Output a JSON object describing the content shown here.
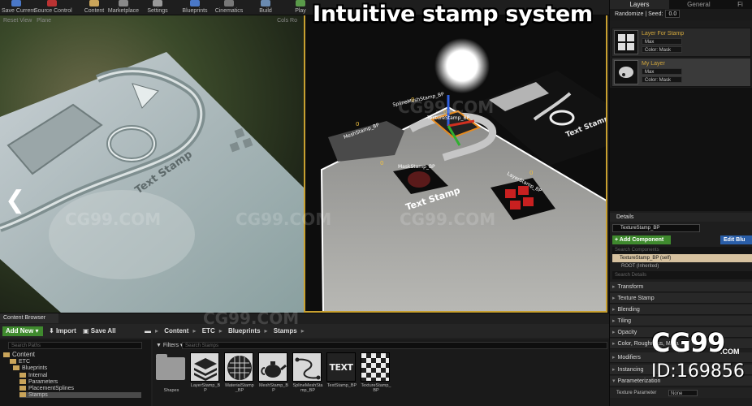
{
  "banner": {
    "title": "Intuitive stamp system"
  },
  "toolbar": {
    "buttons": [
      {
        "label": "Save Current"
      },
      {
        "label": "Source Control"
      },
      {
        "label": "Content"
      },
      {
        "label": "Marketplace"
      },
      {
        "label": "Settings"
      },
      {
        "label": "Blueprints"
      },
      {
        "label": "Cinematics"
      },
      {
        "label": "Build"
      },
      {
        "label": "Play"
      }
    ]
  },
  "viewport_left": {
    "header_left": "Reset View",
    "header_mode": "Plane",
    "header_right": "Cols Ro",
    "surface_text": "Text Stamp"
  },
  "viewport_right": {
    "labels": {
      "spline": "SplineMeshStamp_BP",
      "mesh": "MeshStamp_BP",
      "texture": "TextureStamp_BP",
      "mask": "MaskStamp_BP",
      "layer": "LayerStamp_BP",
      "zero": "0"
    },
    "surface_text": "Text Stamp",
    "dark_plate_text": "Text Stamp"
  },
  "layers_panel": {
    "tabs": [
      "Layers",
      "General",
      "Fi"
    ],
    "randomize_label": "Randomize | Seed:",
    "seed_value": "0.0",
    "layers": [
      {
        "name": "Layer For Stamp",
        "mode": "Max",
        "color": "Color: Mask"
      },
      {
        "name": "My Layer",
        "mode": "Max",
        "color": "Color: Mask"
      }
    ]
  },
  "details_panel": {
    "tab": "Details",
    "object_name": "TextureStamp_BP",
    "add_component": "+ Add Component",
    "edit_blueprint": "Edit Blu",
    "search_components": "Search Components",
    "self_component": "TextureStamp_BP (self)",
    "root_component": "ROOT (Inherited)",
    "search_details": "Search Details",
    "categories": [
      "Transform",
      "Texture Stamp",
      "Blending",
      "Tiling",
      "Opacity",
      "Color, Roughness, Meta",
      "Modifiers",
      "Instancing",
      "Parameterization"
    ],
    "texture_parameter_label": "Texture Parameter",
    "texture_parameter_value": "None"
  },
  "content_browser": {
    "tab": "Content Browser",
    "add_new": "Add New",
    "import": "Import",
    "save_all": "Save All",
    "breadcrumb": [
      "Content",
      "ETC",
      "Blueprints",
      "Stamps"
    ],
    "search_paths": "Search Paths",
    "filters": "Filters",
    "search_assets": "Search Stamps",
    "tree": [
      {
        "label": "Content",
        "depth": 0
      },
      {
        "label": "ETC",
        "depth": 1
      },
      {
        "label": "Blueprints",
        "depth": 2
      },
      {
        "label": "Internal",
        "depth": 3
      },
      {
        "label": "Parameters",
        "depth": 3
      },
      {
        "label": "PlacementSplines",
        "depth": 3
      },
      {
        "label": "Stamps",
        "depth": 3
      }
    ],
    "assets": [
      {
        "label": "Shapes"
      },
      {
        "label": "LayerStamp_BP"
      },
      {
        "label": "MaterialStamp_BP"
      },
      {
        "label": "MeshStamp_BP"
      },
      {
        "label": "SplineMeshStamp_BP"
      },
      {
        "label": "TextStamp_BP"
      },
      {
        "label": "TextureStamp_BP"
      }
    ],
    "text_thumb": "TEXT"
  },
  "watermark": {
    "logo": "CG99",
    "domain": ".COM",
    "id": "ID:169856",
    "overlay": "CG99.COM"
  },
  "colors": {
    "accent_green": "#3f8a2e",
    "accent_blue": "#2a5ea8",
    "selection_orange": "#c8a030",
    "layer_name": "#d2a73c"
  }
}
